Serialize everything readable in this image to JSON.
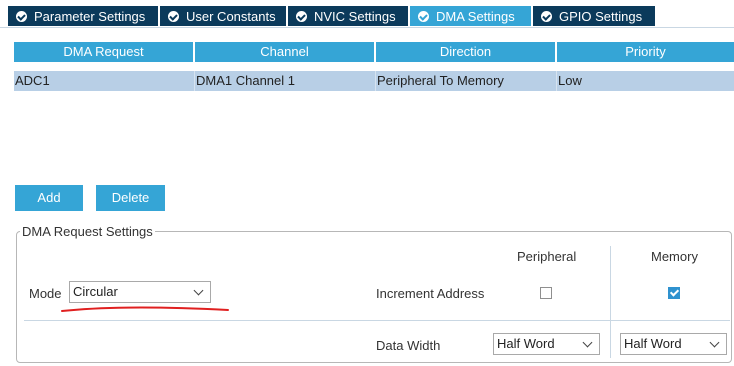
{
  "tabs": [
    {
      "label": "Parameter Settings",
      "active": false
    },
    {
      "label": "User Constants",
      "active": false
    },
    {
      "label": "NVIC Settings",
      "active": false
    },
    {
      "label": "DMA Settings",
      "active": true
    },
    {
      "label": "GPIO Settings",
      "active": false
    }
  ],
  "table": {
    "headers": [
      "DMA Request",
      "Channel",
      "Direction",
      "Priority"
    ],
    "rows": [
      [
        "ADC1",
        "DMA1 Channel 1",
        "Peripheral To Memory",
        "Low"
      ]
    ]
  },
  "buttons": {
    "add": "Add",
    "delete": "Delete"
  },
  "settings": {
    "legend": "DMA Request Settings",
    "mode_label": "Mode",
    "mode_value": "Circular",
    "peripheral_header": "Peripheral",
    "memory_header": "Memory",
    "increment_label": "Increment Address",
    "peripheral_increment": false,
    "memory_increment": true,
    "data_width_label": "Data Width",
    "peripheral_width": "Half Word",
    "memory_width": "Half Word"
  },
  "colors": {
    "tab_bg": "#0b3a5b",
    "tab_active_bg": "#35a5d6",
    "header_bg": "#35a5d6",
    "row_selected_bg": "#b8cfe6",
    "annotation_red": "#e02020"
  }
}
